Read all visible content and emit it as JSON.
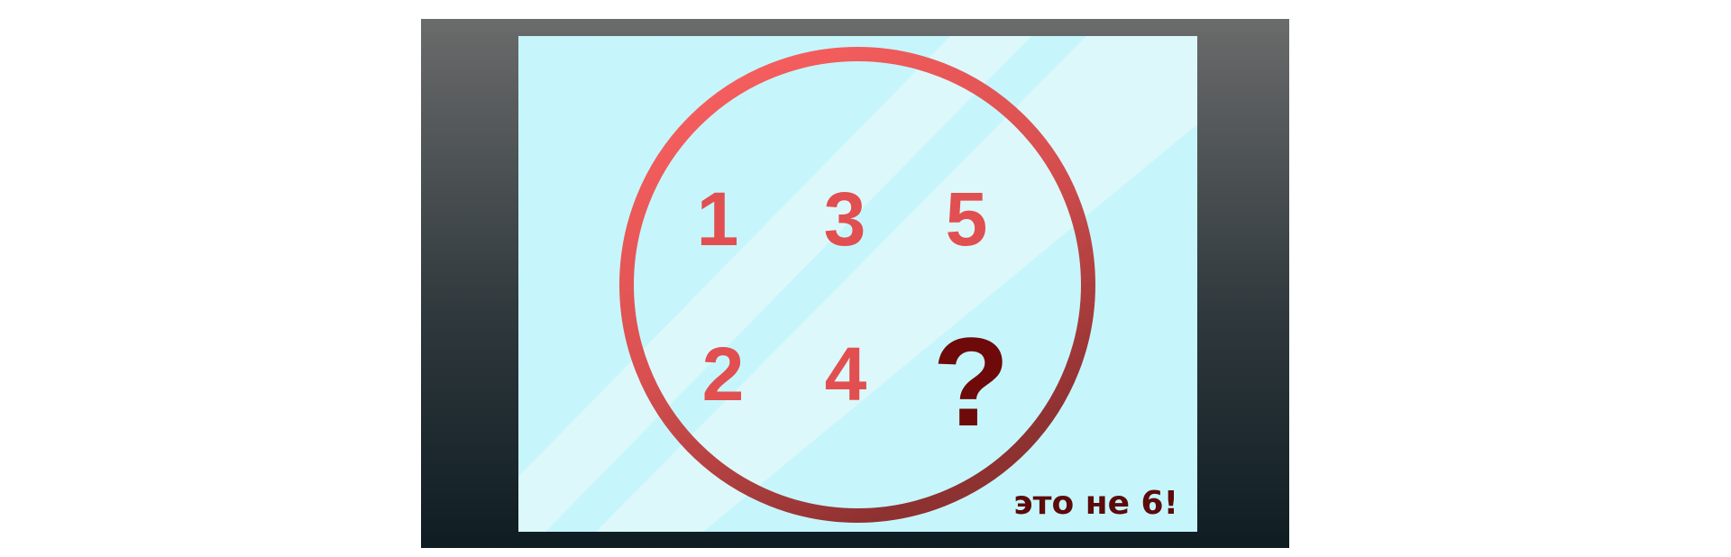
{
  "puzzle": {
    "numbers": [
      "1",
      "3",
      "5",
      "2",
      "4"
    ],
    "unknown": "?",
    "caption": "это не 6!"
  },
  "colors": {
    "frame_top": "#6a6b6b",
    "frame_bottom": "#0f1d23",
    "screen": "#c6f6fb",
    "glare": "#ddf9fc",
    "accent_light": "#ff6060",
    "accent_dark": "#8b3030",
    "question": "#6e0a0a"
  }
}
